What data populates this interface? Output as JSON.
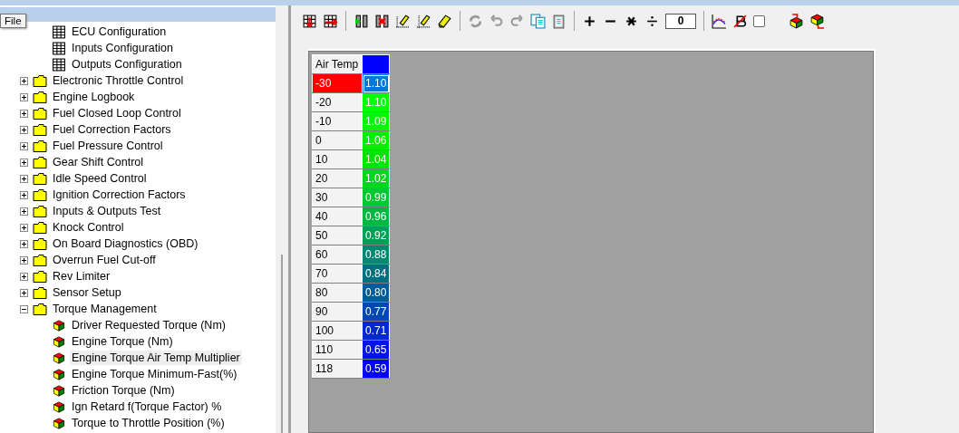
{
  "tooltip": "File",
  "tree_top_children": [
    {
      "kind": "table",
      "label": "ECU Configuration"
    },
    {
      "kind": "table",
      "label": "Inputs Configuration"
    },
    {
      "kind": "table",
      "label": "Outputs Configuration"
    }
  ],
  "tree": [
    {
      "kind": "folder",
      "label": "Electronic Throttle Control",
      "expanded": false
    },
    {
      "kind": "folder",
      "label": "Engine Logbook",
      "expanded": false
    },
    {
      "kind": "folder",
      "label": "Fuel Closed Loop Control",
      "expanded": false
    },
    {
      "kind": "folder",
      "label": "Fuel Correction Factors",
      "expanded": false
    },
    {
      "kind": "folder",
      "label": "Fuel Pressure Control",
      "expanded": false
    },
    {
      "kind": "folder",
      "label": "Gear Shift Control",
      "expanded": false
    },
    {
      "kind": "folder",
      "label": "Idle Speed Control",
      "expanded": false
    },
    {
      "kind": "folder",
      "label": "Ignition Correction Factors",
      "expanded": false
    },
    {
      "kind": "folder",
      "label": "Inputs & Outputs Test",
      "expanded": false
    },
    {
      "kind": "folder",
      "label": "Knock Control",
      "expanded": false
    },
    {
      "kind": "folder",
      "label": "On Board Diagnostics (OBD)",
      "expanded": false
    },
    {
      "kind": "folder",
      "label": "Overrun Fuel Cut-off",
      "expanded": false
    },
    {
      "kind": "folder",
      "label": "Rev Limiter",
      "expanded": false
    },
    {
      "kind": "folder",
      "label": "Sensor Setup",
      "expanded": false
    },
    {
      "kind": "folder",
      "label": "Torque Management",
      "expanded": true,
      "children": [
        {
          "kind": "map",
          "label": "Driver Requested Torque (Nm)",
          "selected": false
        },
        {
          "kind": "map",
          "label": "Engine Torque (Nm)",
          "selected": false
        },
        {
          "kind": "map",
          "label": "Engine Torque Air Temp Multiplier",
          "selected": true
        },
        {
          "kind": "map",
          "label": "Engine Torque Minimum-Fast(%)",
          "selected": false
        },
        {
          "kind": "map",
          "label": "Friction Torque (Nm)",
          "selected": false
        },
        {
          "kind": "map",
          "label": "Ign Retard f(Torque Factor) %",
          "selected": false
        },
        {
          "kind": "map",
          "label": "Torque to Throttle Position (%)",
          "selected": false
        }
      ]
    }
  ],
  "toolbar": {
    "value": "0",
    "checkbox_checked": false
  },
  "table": {
    "header": "Air Temp",
    "rows": [
      {
        "axis": "-30",
        "value": "1.10",
        "color": "#0078d7",
        "selected": true
      },
      {
        "axis": "-20",
        "value": "1.10",
        "color": "#00ff00",
        "selected": false
      },
      {
        "axis": "-10",
        "value": "1.09",
        "color": "#00f800",
        "selected": false
      },
      {
        "axis": "0",
        "value": "1.06",
        "color": "#00ee00",
        "selected": false
      },
      {
        "axis": "10",
        "value": "1.04",
        "color": "#00e400",
        "selected": false
      },
      {
        "axis": "20",
        "value": "1.02",
        "color": "#00d820",
        "selected": false
      },
      {
        "axis": "30",
        "value": "0.99",
        "color": "#00c830",
        "selected": false
      },
      {
        "axis": "40",
        "value": "0.96",
        "color": "#00b840",
        "selected": false
      },
      {
        "axis": "50",
        "value": "0.92",
        "color": "#00a058",
        "selected": false
      },
      {
        "axis": "60",
        "value": "0.88",
        "color": "#008870",
        "selected": false
      },
      {
        "axis": "70",
        "value": "0.84",
        "color": "#007080",
        "selected": false
      },
      {
        "axis": "80",
        "value": "0.80",
        "color": "#005c98",
        "selected": false
      },
      {
        "axis": "90",
        "value": "0.77",
        "color": "#0048b0",
        "selected": false
      },
      {
        "axis": "100",
        "value": "0.71",
        "color": "#0028d0",
        "selected": false
      },
      {
        "axis": "110",
        "value": "0.65",
        "color": "#0014e8",
        "selected": false
      },
      {
        "axis": "118",
        "value": "0.59",
        "color": "#0000ff",
        "selected": false
      }
    ]
  }
}
